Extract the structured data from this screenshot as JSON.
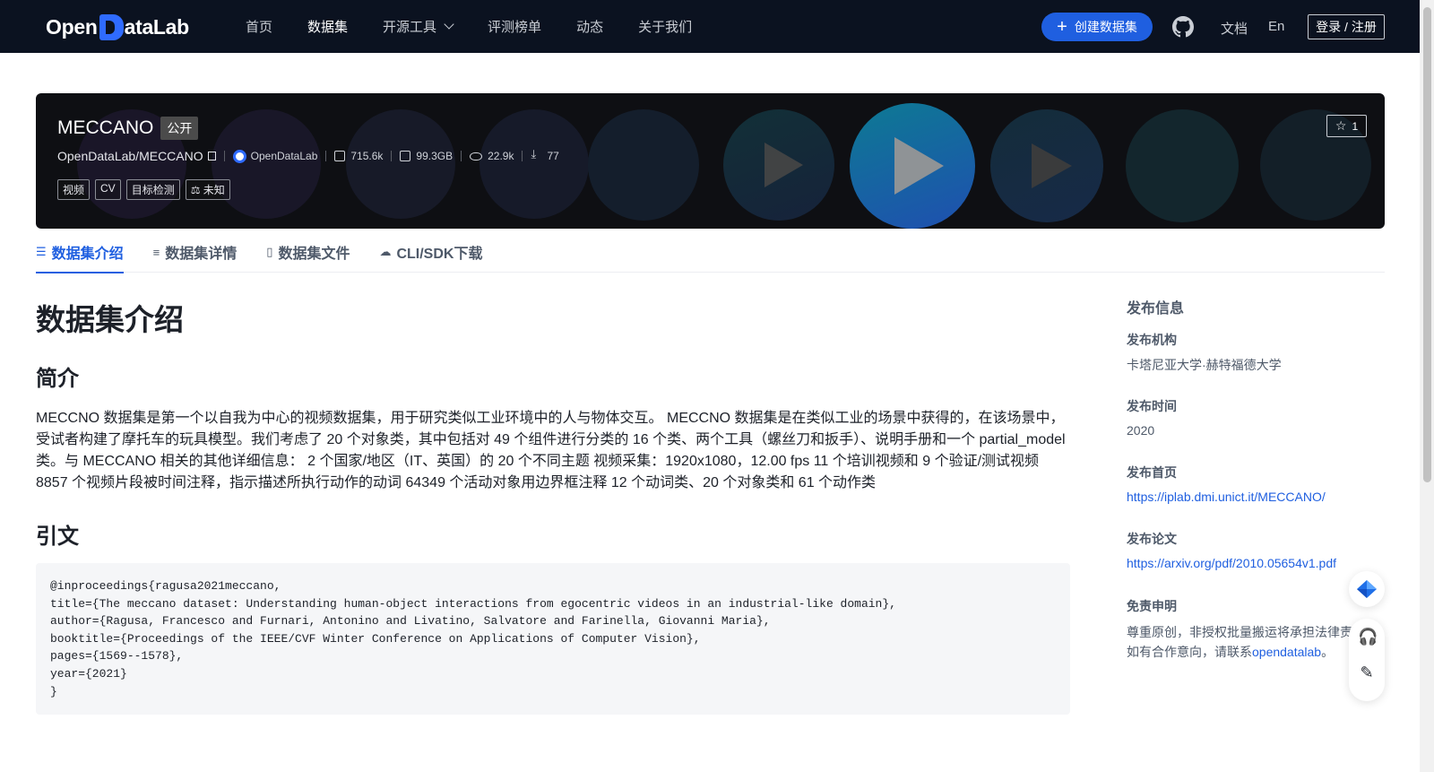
{
  "nav": {
    "brand": "OpenDataLab",
    "links": [
      {
        "label": "首页"
      },
      {
        "label": "数据集"
      },
      {
        "label": "开源工具"
      },
      {
        "label": "评测榜单"
      },
      {
        "label": "动态"
      },
      {
        "label": "关于我们"
      }
    ],
    "create_label": "创建数据集",
    "docs_label": "文档",
    "lang_label": "En",
    "login_label": "登录 / 注册"
  },
  "dataset": {
    "name": "MECCANO",
    "visibility": "公开",
    "repo": "OpenDataLab/MECCANO",
    "org": "OpenDataLab",
    "file_count": "715.6k",
    "size": "99.3GB",
    "views": "22.9k",
    "downloads": "77",
    "stars": "1",
    "tags": [
      "视频",
      "CV",
      "目标检测",
      "未知"
    ]
  },
  "tabs": [
    {
      "label": "数据集介绍",
      "icon": "stack-icon"
    },
    {
      "label": "数据集详情",
      "icon": "list-icon"
    },
    {
      "label": "数据集文件",
      "icon": "file-icon"
    },
    {
      "label": "CLI/SDK下载",
      "icon": "cloud-download-icon"
    }
  ],
  "main": {
    "title": "数据集介绍",
    "intro_heading": "简介",
    "intro_text": "MECCNO 数据集是第一个以自我为中心的视频数据集，用于研究类似工业环境中的人与物体交互。 MECCNO 数据集是在类似工业的场景中获得的，在该场景中，受试者构建了摩托车的玩具模型。我们考虑了 20 个对象类，其中包括对 49 个组件进行分类的 16 个类、两个工具（螺丝刀和扳手）、说明手册和一个 partial_model 类。与 MECCANO 相关的其他详细信息： 2 个国家/地区（IT、英国）的 20 个不同主题 视频采集：1920x1080，12.00 fps 11 个培训视频和 9 个验证/测试视频 8857 个视频片段被时间注释，指示描述所执行动作的动词 64349 个活动对象用边界框注释 12 个动词类、20 个对象类和 61 个动作类",
    "citation_heading": "引文",
    "citation_code": "@inproceedings{ragusa2021meccano,\ntitle={The meccano dataset: Understanding human-object interactions from egocentric videos in an industrial-like domain},\nauthor={Ragusa, Francesco and Furnari, Antonino and Livatino, Salvatore and Farinella, Giovanni Maria},\nbooktitle={Proceedings of the IEEE/CVF Winter Conference on Applications of Computer Vision},\npages={1569--1578},\nyear={2021}\n}"
  },
  "sidebar": {
    "title": "发布信息",
    "org_label": "发布机构",
    "org_value": "卡塔尼亚大学·赫特福德大学",
    "time_label": "发布时间",
    "time_value": "2020",
    "home_label": "发布首页",
    "home_url": "https://iplab.dmi.unict.it/MECCANO/",
    "paper_label": "发布论文",
    "paper_url": "https://arxiv.org/pdf/2010.05654v1.pdf",
    "disclaimer_label": "免责申明",
    "disclaimer_line1": "尊重原创，非授权批量搬运将承担法律责",
    "disclaimer_line2": "如有合作意向，请联系",
    "disclaimer_link": "opendatalab",
    "disclaimer_end": "。"
  },
  "colors": {
    "nav_bg": "#0b1220",
    "accent": "#1f5fe0",
    "banner_bg": "#0e0f13"
  }
}
